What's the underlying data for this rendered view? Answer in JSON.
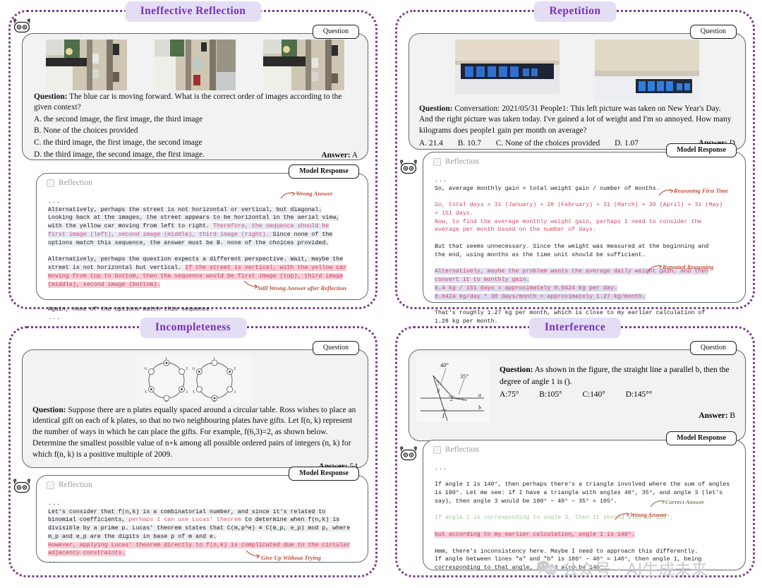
{
  "panels": [
    {
      "title": "Ineffective Reflection",
      "question_tab": "Question",
      "response_tab": "Model Response",
      "reflection_label": "Reflection",
      "question_prefix": "Question:",
      "question_body": " The blue car is moving forward. What is the correct order of images according to the given context?",
      "options": [
        "A. the second image, the first image, the third image",
        "B. None of the choices provided",
        "C. the third image, the first image, the second image",
        "D. the third image, the second image, the first image."
      ],
      "answer_label": "Answer:",
      "answer_value": "A",
      "images_alt": [
        "aerial-traffic-frame-1",
        "aerial-traffic-frame-2",
        "aerial-traffic-frame-3"
      ],
      "annotations": [
        {
          "text": "Wrong Answer"
        },
        {
          "text": "Still Wrong Answer after Reflection"
        }
      ],
      "response_lines": [
        {
          "t": "...",
          "c": "dots"
        },
        {
          "t": "Alternatively, perhaps the street is not horizontal or vertical, but diagonal.",
          "c": "hi-gray"
        },
        {
          "t": "Looking back at the images, the street appears to be horizontal in the aerial view,",
          "c": "hi-gray"
        },
        {
          "t": "with the yellow car moving from left to right. ",
          "c": "hi-gray",
          "t2": "Therefore, the sequence should be",
          "c2": "hi-blue"
        },
        {
          "t": "first image (left), second image (middle), third image (right). ",
          "c": "hi-blue",
          "t2": "Since none of the",
          "c2": "hi-gray"
        },
        {
          "t": "options match this sequence, the answer must be B. none of the choices provided.",
          "c": "hi-gray"
        },
        {
          "t": "",
          "c": ""
        },
        {
          "t": "Alternatively, perhaps the question expects a different perspective. Wait, maybe the",
          "c": "hi-gray"
        },
        {
          "t": "street is not horizontal but vertical. ",
          "c": "hi-gray",
          "t2": "If the street is vertical, with the yellow car",
          "c2": "hi-rose"
        },
        {
          "t": "moving from top to bottom, then the sequence would be first image (top), third image",
          "c": "hi-rose"
        },
        {
          "t": "(middle), second image (bottom).",
          "c": "hi-rose"
        },
        {
          "t": "",
          "c": ""
        },
        {
          "t": "Again, none of the options match this sequence.",
          "c": ""
        },
        {
          "t": "...",
          "c": "dots"
        }
      ]
    },
    {
      "title": "Repetition",
      "question_tab": "Question",
      "response_tab": "Model Response",
      "reflection_label": "Reflection",
      "question_prefix": "Question:",
      "question_body": " Conversation: 2021/05/31 People1: This left picture was taken on New Year's Day. And the right picture was taken today. I've gained a lot of weight and I'm so annoyed.  How many kilograms does people1 gain per month on average?",
      "options_inline": [
        "A. 21.4",
        "B. 10.7",
        "C. None of the choices provided",
        "D. 1.07"
      ],
      "answer_label": "Answer:",
      "answer_value": "D",
      "images_alt": [
        "digital-scale-photo-left",
        "digital-scale-photo-right"
      ],
      "annotations": [
        {
          "text": "Reasoning First Time"
        },
        {
          "text": "Repeated Reasoning"
        }
      ],
      "response_lines": [
        {
          "t": "...",
          "c": "dots"
        },
        {
          "t": "So, average monthly gain = total weight gain / number of months.",
          "c": ""
        },
        {
          "t": "",
          "c": ""
        },
        {
          "t": "So, total days = 31 (January) + 28 (February) + 31 (March) + 30 (April) + 31 (May)",
          "c": "red"
        },
        {
          "t": "= 151 days.",
          "c": "red"
        },
        {
          "t": "Now, to find the average monthly weight gain, perhaps I need to consider the",
          "c": "red"
        },
        {
          "t": "average per month based on the number of days.",
          "c": "red"
        },
        {
          "t": "",
          "c": ""
        },
        {
          "t": "But that seems unnecessary. Since the weight was measured at the beginning and",
          "c": ""
        },
        {
          "t": "the end, using months as the time unit should be sufficient.",
          "c": ""
        },
        {
          "t": "",
          "c": ""
        },
        {
          "t": "Alternatively, maybe the problem wants the average daily weight gain, and then",
          "c": "hi-lav"
        },
        {
          "t": "convert it to monthly gain.",
          "c": "hi-lav"
        },
        {
          "t": "6.4 kg / 151 days = approximately 0.0424 kg per day.",
          "c": "hi-lav2"
        },
        {
          "t": "0.0424 kg/day * 30 days/month = approximately 1.27 kg/month.",
          "c": "hi-lav2"
        },
        {
          "t": "",
          "c": ""
        },
        {
          "t": "That's roughly 1.27 kg per month, which is close to my earlier calculation of",
          "c": ""
        },
        {
          "t": "1.28 kg per month.",
          "c": ""
        },
        {
          "t": "...",
          "c": "dots"
        }
      ]
    },
    {
      "title": "Incompleteness",
      "question_tab": "Question",
      "response_tab": "Model Response",
      "reflection_label": "Reflection",
      "question_prefix": "Question:",
      "question_body": " Suppose there are n plates equally spaced around a circular table. Ross wishes to place an identical gift on each of k plates, so that no two neighbouring plates have gifts. Let f(n, k) represent the number of ways in which he can place the gifts. For example, f(6,3)=2, as shown below.",
      "question_body2": "Determine the smallest possible value of n+k among all possible ordered pairs of integers (n, k) for which f(n, k) is a positive multiple of 2009.",
      "answer_label": "Answer:",
      "answer_value": "54",
      "figure_alt": "two-circular-tables-with-6-plates",
      "plate_labels": [
        "1",
        "2",
        "3",
        "4",
        "5",
        "6"
      ],
      "annotations": [
        {
          "text": "Give Up Without Trying"
        }
      ],
      "response_lines": [
        {
          "t": "...",
          "c": "dots"
        },
        {
          "t": "Let's consider that f(n,k) is a combinatorial number, and since it's related to",
          "c": "hi-gray"
        },
        {
          "t": "binomial coefficients, ",
          "c": "hi-gray",
          "t2": "perhaps I can use Lucas' theorem ",
          "c2": "pink",
          "t3": "to determine when f(n,k) is",
          "c3": "hi-gray"
        },
        {
          "t": "divisible by a prime p. Lucas' theorem states that C(m,p^e) ≡ C(m_p, e_p) mod p, where",
          "c": "hi-gray"
        },
        {
          "t": "m_p and e_p are the digits in base p of m and e.",
          "c": "hi-gray"
        },
        {
          "t": "However, applying Lucas' theorem directly to f(n,k) is complicated due to the circular",
          "c": "hi-rose"
        },
        {
          "t": "adjacency constraints.",
          "c": "hi-rose"
        },
        {
          "t": "...",
          "c": "dots"
        }
      ]
    },
    {
      "title": "Interference",
      "question_tab": "Question",
      "response_tab": "Model Response",
      "reflection_label": "Reflection",
      "question_prefix": "Question:",
      "question_body": " As shown in the figure, the straight line a parallel b, then the degree of angle 1 is ().",
      "options_inline": [
        "A:75°",
        "B:105°",
        "C:140°",
        "D:145°°"
      ],
      "answer_label": "Answer:",
      "answer_value": "B",
      "figure_alt": "parallel-lines-with-transversal-angles",
      "figure_labels": {
        "a40": "40°",
        "a35": "35°",
        "l3": "3",
        "l2": "2",
        "l1": "1",
        "la": "a",
        "lb": "b"
      },
      "annotations": [
        {
          "text": "Correct Answer"
        },
        {
          "text": "Wrong Answer"
        }
      ],
      "response_lines": [
        {
          "t": "...",
          "c": "dots"
        },
        {
          "t": "",
          "c": ""
        },
        {
          "t": "If angle 1 is 140°, then perhaps there's a triangle involved where the sum of angles",
          "c": ""
        },
        {
          "t": "is 180°. Let me see: if I have a triangle with angles 40°, 35°, and angle 3 (let's",
          "c": ""
        },
        {
          "t": "say), then angle 3 would be 180° − 40° − 35° = 105°.",
          "c": ""
        },
        {
          "t": "",
          "c": ""
        },
        {
          "t": "If angle 1 is corresponding to angle 3, then it should also be 105°,",
          "c": "green"
        },
        {
          "t": "",
          "c": ""
        },
        {
          "t": "but according to my earlier calculation, angle 1 is 140°.",
          "c": "hi-rose"
        },
        {
          "t": "",
          "c": ""
        },
        {
          "t": "Hmm, there's inconsistency here. Maybe I need to approach this differently.",
          "c": ""
        },
        {
          "t": "If angle between lines \"a\" and \"b\" is 180° − 40° = 140°, then angle 1, being",
          "c": ""
        },
        {
          "t": "corresponding to that angle, should also be 140°.",
          "c": ""
        },
        {
          "t": "...",
          "c": "dots"
        }
      ]
    }
  ],
  "watermark": {
    "text": "公众号 · AI生成未来",
    "icon": "wechat-icon"
  },
  "colors": {
    "panel_border": "#7c3d8a",
    "title_bg": "#e4def5",
    "title_text": "#7b2fbe",
    "highlight_pink": "#fbdfe6",
    "highlight_blue": "#e3e6f6",
    "annotation": "#c0513c",
    "annotation_green": "#6b8f5e"
  }
}
